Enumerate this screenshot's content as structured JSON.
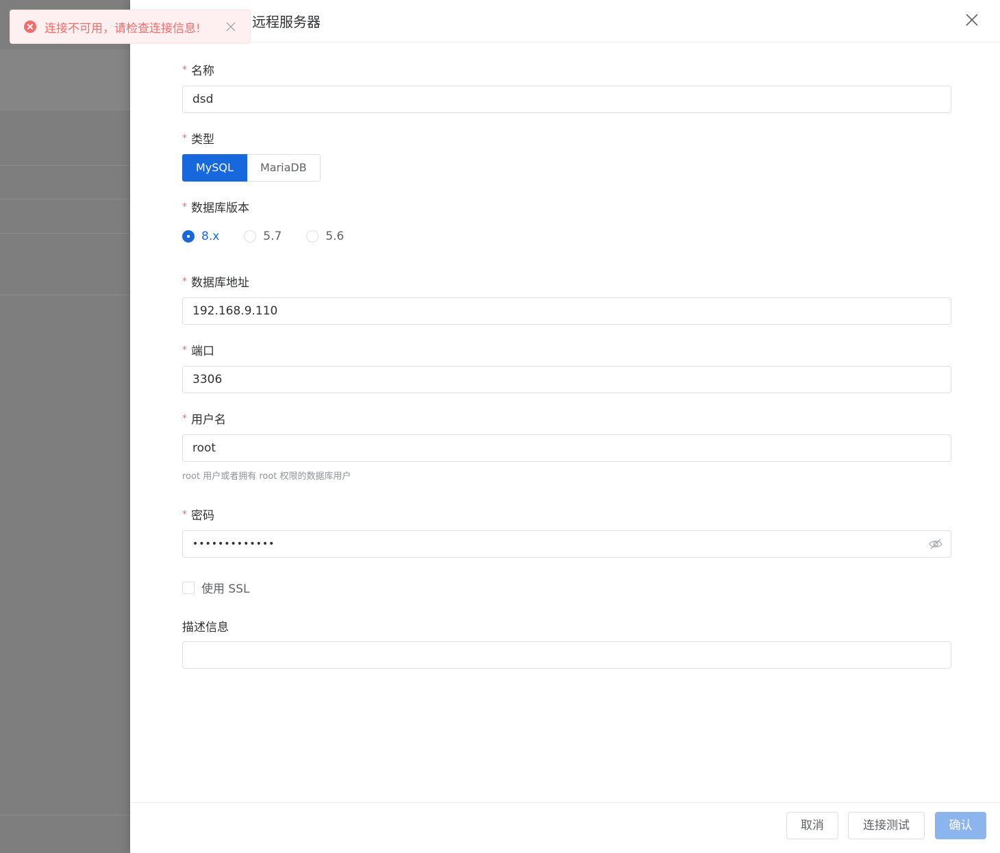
{
  "toast": {
    "message": "连接不可用，请检查连接信息!",
    "type": "error"
  },
  "drawer": {
    "title": "远程服务器"
  },
  "form": {
    "name": {
      "label": "名称",
      "value": "dsd"
    },
    "type": {
      "label": "类型",
      "options": [
        "MySQL",
        "MariaDB"
      ],
      "selected": "MySQL"
    },
    "version": {
      "label": "数据库版本",
      "options": [
        "8.x",
        "5.7",
        "5.6"
      ],
      "selected": "8.x"
    },
    "address": {
      "label": "数据库地址",
      "value": "192.168.9.110"
    },
    "port": {
      "label": "端口",
      "value": "3306"
    },
    "username": {
      "label": "用户名",
      "value": "root",
      "hint": "root 用户或者拥有 root 权限的数据库用户"
    },
    "password": {
      "label": "密码",
      "value": "•••••••••••••"
    },
    "ssl": {
      "label": "使用 SSL",
      "checked": false
    },
    "description": {
      "label": "描述信息",
      "value": ""
    }
  },
  "footer": {
    "cancel": "取消",
    "test": "连接测试",
    "confirm": "确认"
  },
  "colors": {
    "primary": "#1668dc",
    "error": "#f56c6c",
    "required": "#f56c6c"
  }
}
